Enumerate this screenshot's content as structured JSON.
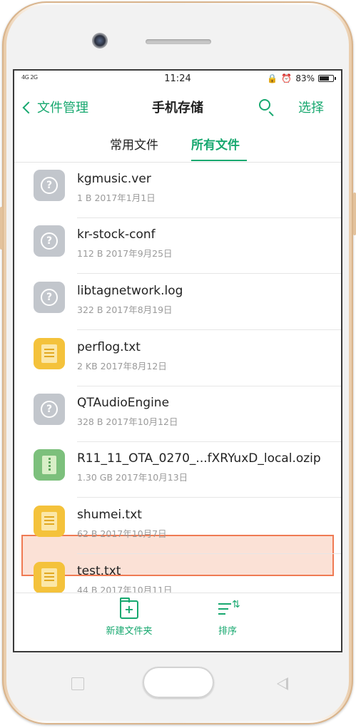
{
  "status_bar": {
    "signal": "4G 2G",
    "time": "11:24",
    "battery": "83%",
    "battery_level": 0.83
  },
  "header": {
    "back_label": "文件管理",
    "title": "手机存储",
    "select_label": "选择"
  },
  "tabs": [
    {
      "label": "常用文件",
      "active": false
    },
    {
      "label": "所有文件",
      "active": true
    }
  ],
  "files": [
    {
      "name": "kgmusic.ver",
      "meta": "1 B  2017年1月1日",
      "icon": "unknown-file-icon"
    },
    {
      "name": "kr-stock-conf",
      "meta": "112 B  2017年9月25日",
      "icon": "unknown-file-icon"
    },
    {
      "name": "libtagnetwork.log",
      "meta": "322 B  2017年8月19日",
      "icon": "unknown-file-icon"
    },
    {
      "name": "perflog.txt",
      "meta": "2 KB  2017年8月12日",
      "icon": "text-file-icon"
    },
    {
      "name": "QTAudioEngine",
      "meta": "328 B  2017年10月12日",
      "icon": "unknown-file-icon"
    },
    {
      "name": "R11_11_OTA_0270_...fXRYuxD_local.ozip",
      "meta": "1.30 GB  2017年10月13日",
      "icon": "zip-file-icon",
      "highlighted": true
    },
    {
      "name": "shumei.txt",
      "meta": "62 B  2017年10月7日",
      "icon": "text-file-icon"
    },
    {
      "name": "test.txt",
      "meta": "44 B  2017年10月11日",
      "icon": "text-file-icon"
    }
  ],
  "bottom_bar": {
    "new_folder_label": "新建文件夹",
    "sort_label": "排序"
  },
  "colors": {
    "accent": "#17a86f",
    "highlight_border": "#ef7a53",
    "highlight_fill": "#fbe1d6"
  }
}
